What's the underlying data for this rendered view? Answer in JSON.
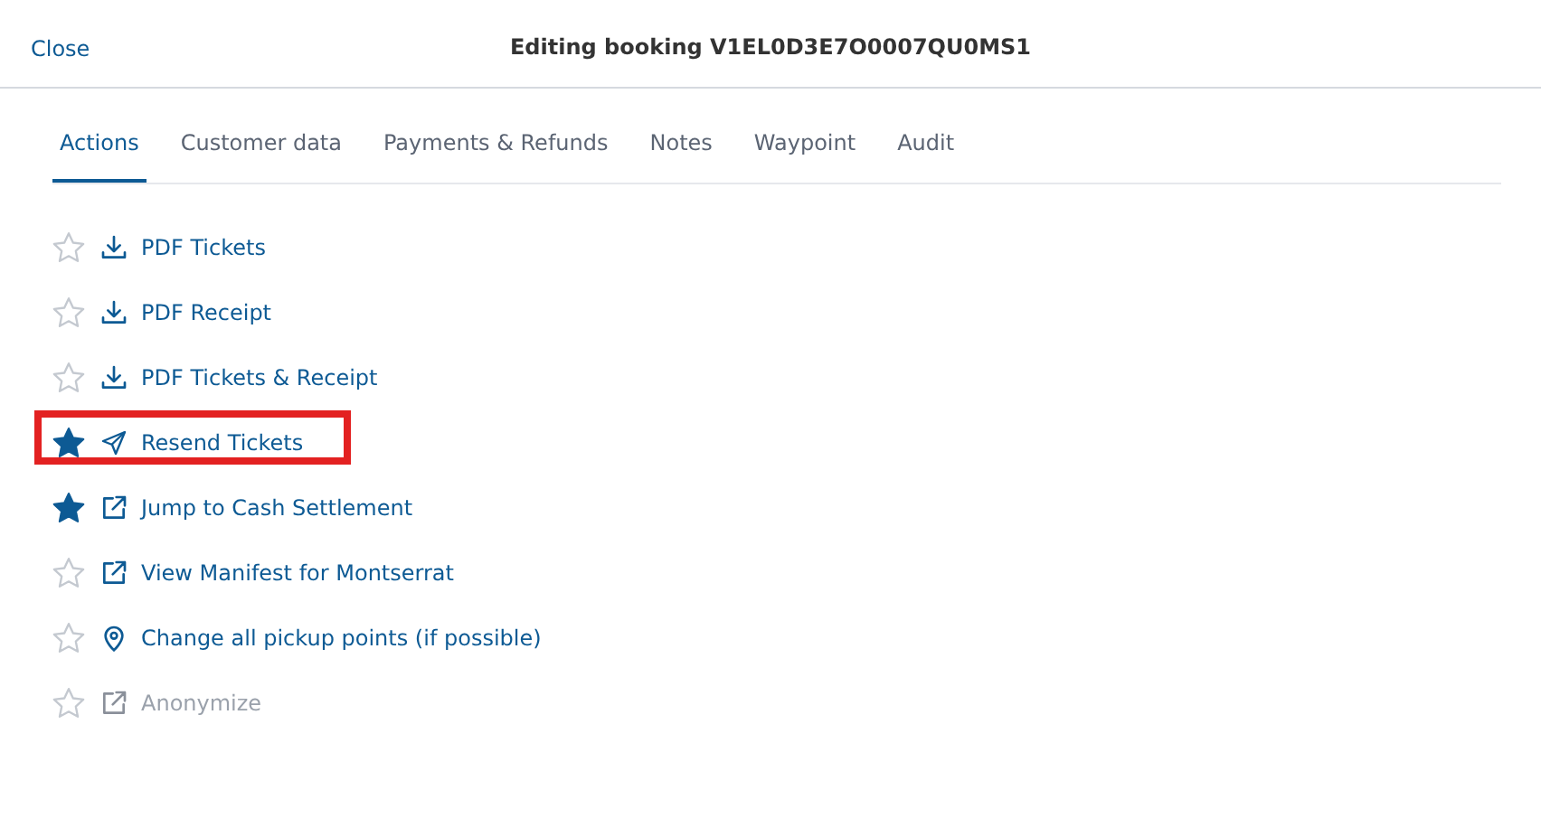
{
  "header": {
    "close": "Close",
    "title": "Editing booking V1EL0D3E7O0007QU0MS1"
  },
  "tabs": [
    {
      "label": "Actions",
      "selected": true
    },
    {
      "label": "Customer data",
      "selected": false
    },
    {
      "label": "Payments & Refunds",
      "selected": false
    },
    {
      "label": "Notes",
      "selected": false
    },
    {
      "label": "Waypoint",
      "selected": false
    },
    {
      "label": "Audit",
      "selected": false
    }
  ],
  "actions": [
    {
      "label": "PDF Tickets",
      "kind": "download",
      "starred": false,
      "disabled": false,
      "highlighted": false
    },
    {
      "label": "PDF Receipt",
      "kind": "download",
      "starred": false,
      "disabled": false,
      "highlighted": false
    },
    {
      "label": "PDF Tickets & Receipt",
      "kind": "download",
      "starred": false,
      "disabled": false,
      "highlighted": false
    },
    {
      "label": "Resend Tickets",
      "kind": "send",
      "starred": true,
      "disabled": false,
      "highlighted": true
    },
    {
      "label": "Jump to Cash Settlement",
      "kind": "external",
      "starred": true,
      "disabled": false,
      "highlighted": false
    },
    {
      "label": "View Manifest for Montserrat",
      "kind": "external",
      "starred": false,
      "disabled": false,
      "highlighted": false
    },
    {
      "label": "Change all pickup points (if possible)",
      "kind": "pin",
      "starred": false,
      "disabled": false,
      "highlighted": false
    },
    {
      "label": "Anonymize",
      "kind": "external",
      "starred": false,
      "disabled": true,
      "highlighted": false
    }
  ]
}
